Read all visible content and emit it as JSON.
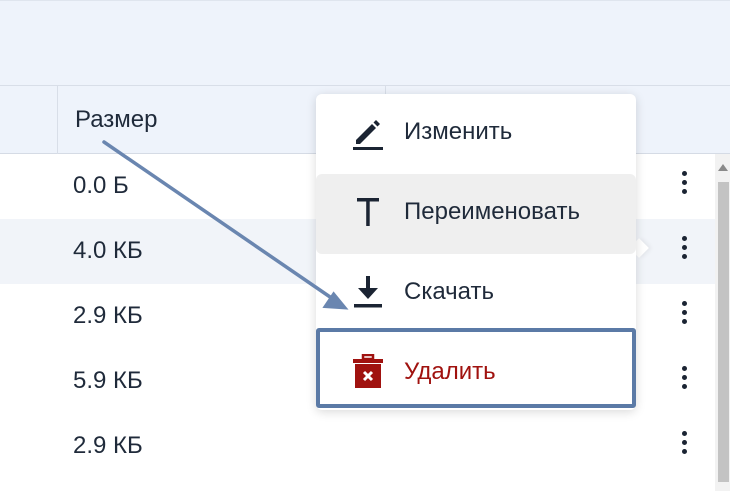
{
  "table": {
    "size_header": "Размер",
    "rows": [
      {
        "size": "0.0 Б"
      },
      {
        "size": "4.0 КБ"
      },
      {
        "size": "2.9 КБ"
      },
      {
        "size": "5.9 КБ"
      },
      {
        "size": "2.9 КБ"
      }
    ]
  },
  "context_menu": {
    "items": [
      {
        "label": "Изменить",
        "icon": "pencil-icon"
      },
      {
        "label": "Переименовать",
        "icon": "text-icon"
      },
      {
        "label": "Скачать",
        "icon": "download-icon"
      },
      {
        "label": "Удалить",
        "icon": "trash-icon"
      }
    ]
  },
  "colors": {
    "header_bg": "#eef3fb",
    "delete_text": "#a0120f",
    "highlight_border": "#5b7aa6"
  }
}
